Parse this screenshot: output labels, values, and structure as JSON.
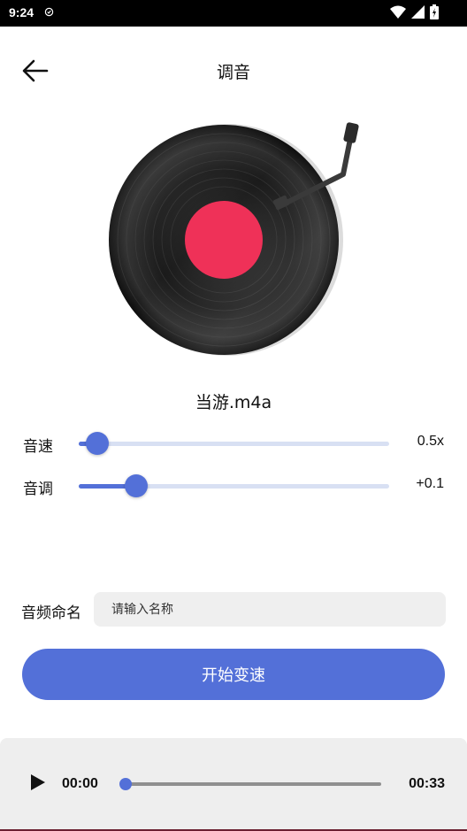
{
  "status_bar": {
    "time": "9:24",
    "icons": [
      "sync-icon",
      "wifi-icon",
      "signal-icon",
      "battery-icon"
    ]
  },
  "header": {
    "title": "调音",
    "back_icon": "arrow-left-icon"
  },
  "record": {
    "icon": "vinyl-record-icon",
    "label_color": "#ef3158"
  },
  "file": {
    "name": "当游.m4a"
  },
  "sliders": [
    {
      "label": "音速",
      "value_text": "0.5x",
      "position": 0.06
    },
    {
      "label": "音调",
      "value_text": "+0.1",
      "position": 0.185
    }
  ],
  "name_field": {
    "label": "音频命名",
    "value": "",
    "placeholder": "请输入名称"
  },
  "start_button": {
    "label": "开始变速"
  },
  "player": {
    "current_time": "00:00",
    "total_time": "00:33",
    "progress": 0.0,
    "play_icon": "play-icon"
  },
  "colors": {
    "accent": "#5370d8",
    "track": "#d8e0f3",
    "input_bg": "#efefef",
    "player_bg": "#eeeeee"
  }
}
